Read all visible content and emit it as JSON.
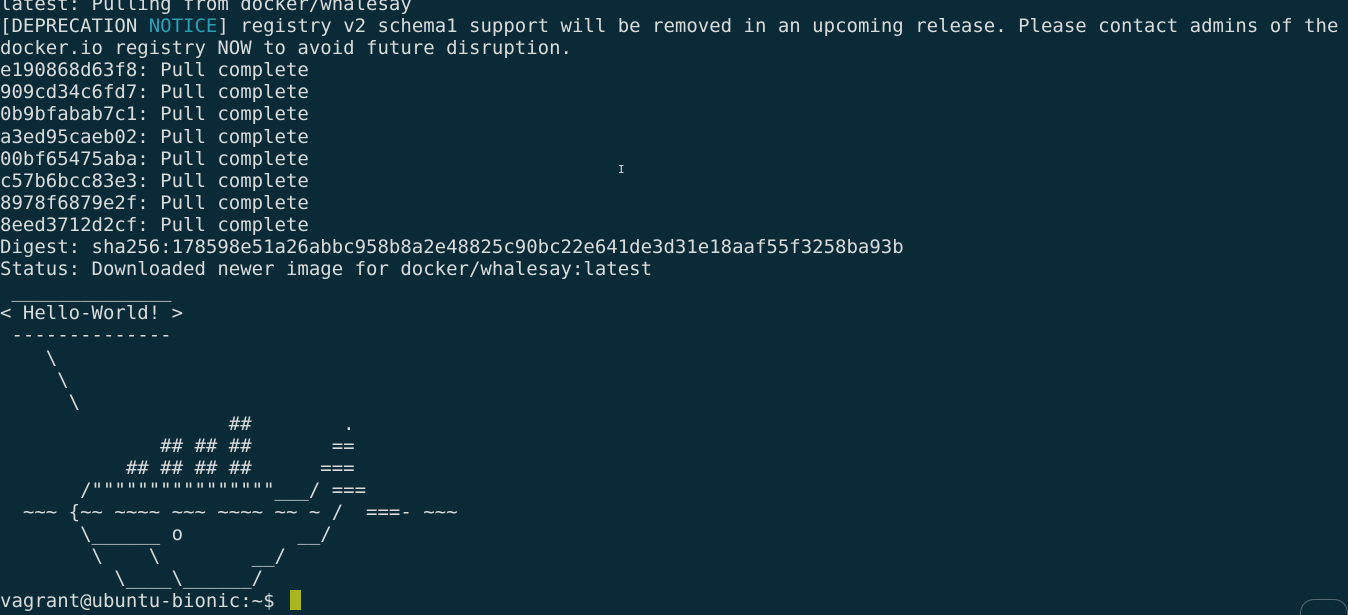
{
  "terminal": {
    "lines": [
      "latest: Pulling from docker/whalesay",
      "[DEPRECATION ",
      "docker.io registry NOW to avoid future disruption.",
      "e190868d63f8: Pull complete",
      "909cd34c6fd7: Pull complete",
      "0b9bfabab7c1: Pull complete",
      "a3ed95caeb02: Pull complete",
      "00bf65475aba: Pull complete",
      "c57b6bcc83e3: Pull complete",
      "8978f6879e2f: Pull complete",
      "8eed3712d2cf: Pull complete",
      "Digest: sha256:178598e51a26abbc958b8a2e48825c90bc22e641de3d31e18aaf55f3258ba93b",
      "Status: Downloaded newer image for docker/whalesay:latest",
      " ______________ ",
      "< Hello-World! >",
      " -------------- ",
      "    \\",
      "     \\",
      "      \\",
      "                    ##        .",
      "              ## ## ##       ==",
      "           ## ## ## ##      ===",
      "       /\"\"\"\"\"\"\"\"\"\"\"\"\"\"\"\"___/ ===",
      "  ~~~ {~~ ~~~~ ~~~ ~~~~ ~~ ~ /  ===- ~~~",
      "       \\______ o          __/",
      "        \\    \\        __/",
      "          \\____\\______/",
      "vagrant@ubuntu-bionic:~$ "
    ],
    "notice_word": "NOTICE",
    "notice_rest": "] registry v2 schema1 support will be removed in an upcoming release. Please contact admins of the",
    "notice_color": "#2aa1b3",
    "cursor_color": "#a8b51c",
    "background": "#0b2a37",
    "foreground": "#d8dcdc",
    "mouse_cursor_icon": "text-ibeam-icon",
    "mouse_cursor_glyph": "I"
  }
}
